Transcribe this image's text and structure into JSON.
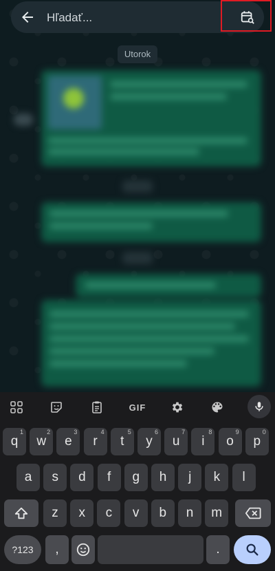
{
  "header": {
    "search_placeholder": "Hľadať...",
    "back_icon": "arrow-left-icon",
    "date_search_icon": "calendar-search-icon",
    "highlight_color": "#e01b24"
  },
  "chat": {
    "date_chip": "Utorok"
  },
  "keyboard": {
    "toolbar": {
      "apps_icon": "grid-icon",
      "sticker_icon": "sticker-icon",
      "clipboard_icon": "clipboard-icon",
      "gif_label": "GIF",
      "settings_icon": "gear-icon",
      "theme_icon": "palette-icon",
      "mic_icon": "microphone-icon"
    },
    "row1": [
      {
        "label": "q",
        "hint": "1"
      },
      {
        "label": "w",
        "hint": "2"
      },
      {
        "label": "e",
        "hint": "3"
      },
      {
        "label": "r",
        "hint": "4"
      },
      {
        "label": "t",
        "hint": "5"
      },
      {
        "label": "y",
        "hint": "6"
      },
      {
        "label": "u",
        "hint": "7"
      },
      {
        "label": "i",
        "hint": "8"
      },
      {
        "label": "o",
        "hint": "9"
      },
      {
        "label": "p",
        "hint": "0"
      }
    ],
    "row2": [
      "a",
      "s",
      "d",
      "f",
      "g",
      "h",
      "j",
      "k",
      "l"
    ],
    "row3": [
      "z",
      "x",
      "c",
      "v",
      "b",
      "n",
      "m"
    ],
    "shift_icon": "shift-icon",
    "backspace_icon": "backspace-icon",
    "symbols_label": "?123",
    "comma_label": ",",
    "emoji_icon": "emoji-icon",
    "period_label": ".",
    "search_key_icon": "search-icon"
  }
}
